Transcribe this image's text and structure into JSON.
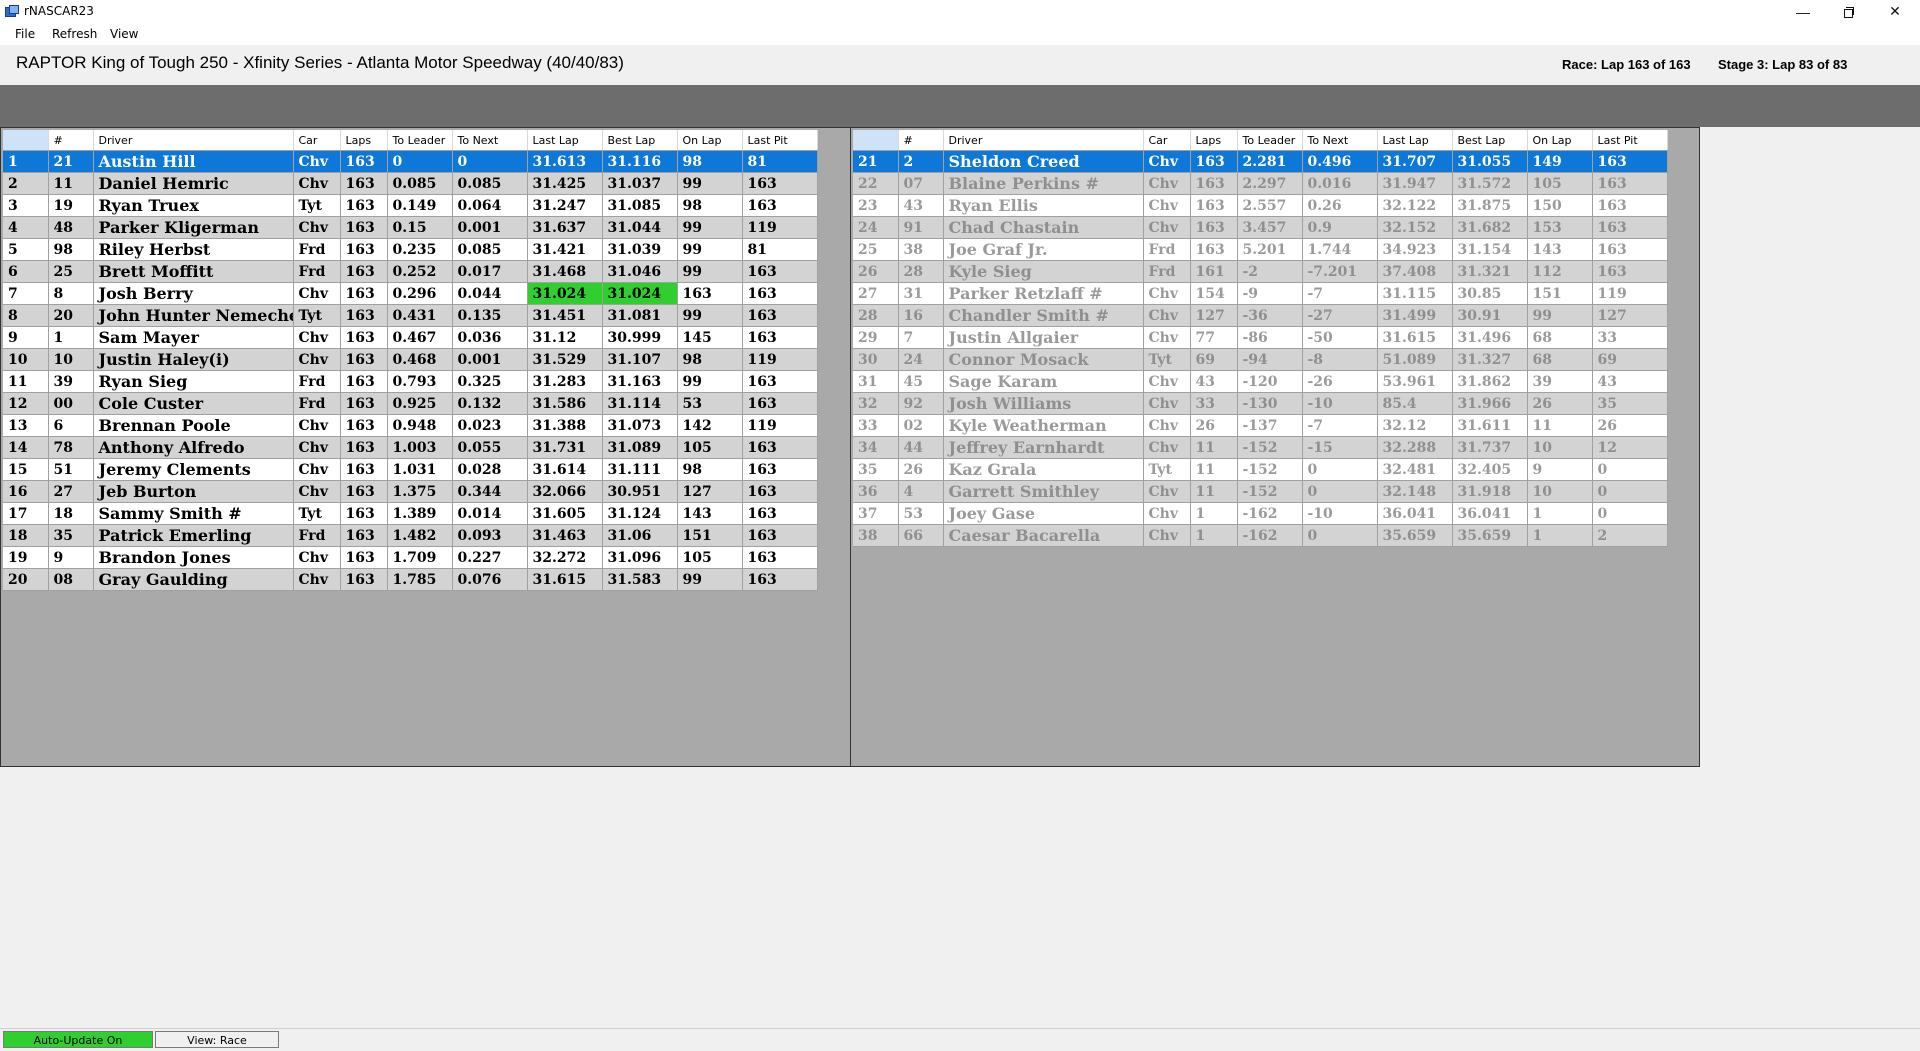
{
  "window": {
    "title": "rNASCAR23",
    "minimize_glyph": "—",
    "close_glyph": "✕"
  },
  "menu": {
    "file": "File",
    "refresh": "Refresh",
    "view": "View"
  },
  "header": {
    "race_title": "RAPTOR King of Tough 250 - Xfinity Series - Atlanta Motor Speedway  (40/40/83)",
    "race_status": "Race: Lap 163 of 163",
    "stage_status": "Stage 3: Lap 83 of 83"
  },
  "columns": [
    "",
    "#",
    "Driver",
    "Car",
    "Laps",
    "To Leader",
    "To Next",
    "Last Lap",
    "Best Lap",
    "On Lap",
    "Last Pit"
  ],
  "colors": {
    "selected": "#0e78d8",
    "best_lap": "#2fcf2f",
    "auto_update": "#2fcf2f"
  },
  "standings_left": [
    {
      "pos": "1",
      "num": "21",
      "driver": "Austin Hill",
      "car": "Chv",
      "laps": "163",
      "to_leader": "0",
      "to_next": "0",
      "last_lap": "31.613",
      "best_lap": "31.116",
      "on_lap": "98",
      "last_pit": "81",
      "selected": true
    },
    {
      "pos": "2",
      "num": "11",
      "driver": "Daniel Hemric",
      "car": "Chv",
      "laps": "163",
      "to_leader": "0.085",
      "to_next": "0.085",
      "last_lap": "31.425",
      "best_lap": "31.037",
      "on_lap": "99",
      "last_pit": "163"
    },
    {
      "pos": "3",
      "num": "19",
      "driver": "Ryan Truex",
      "car": "Tyt",
      "laps": "163",
      "to_leader": "0.149",
      "to_next": "0.064",
      "last_lap": "31.247",
      "best_lap": "31.085",
      "on_lap": "98",
      "last_pit": "163"
    },
    {
      "pos": "4",
      "num": "48",
      "driver": "Parker Kligerman",
      "car": "Chv",
      "laps": "163",
      "to_leader": "0.15",
      "to_next": "0.001",
      "last_lap": "31.637",
      "best_lap": "31.044",
      "on_lap": "99",
      "last_pit": "119"
    },
    {
      "pos": "5",
      "num": "98",
      "driver": "Riley Herbst",
      "car": "Frd",
      "laps": "163",
      "to_leader": "0.235",
      "to_next": "0.085",
      "last_lap": "31.421",
      "best_lap": "31.039",
      "on_lap": "99",
      "last_pit": "81"
    },
    {
      "pos": "6",
      "num": "25",
      "driver": "Brett Moffitt",
      "car": "Frd",
      "laps": "163",
      "to_leader": "0.252",
      "to_next": "0.017",
      "last_lap": "31.468",
      "best_lap": "31.046",
      "on_lap": "99",
      "last_pit": "163"
    },
    {
      "pos": "7",
      "num": "8",
      "driver": "Josh Berry",
      "car": "Chv",
      "laps": "163",
      "to_leader": "0.296",
      "to_next": "0.044",
      "last_lap": "31.024",
      "best_lap": "31.024",
      "on_lap": "163",
      "last_pit": "163",
      "highlight": true
    },
    {
      "pos": "8",
      "num": "20",
      "driver": "John Hunter Nemechek",
      "car": "Tyt",
      "laps": "163",
      "to_leader": "0.431",
      "to_next": "0.135",
      "last_lap": "31.451",
      "best_lap": "31.081",
      "on_lap": "99",
      "last_pit": "163"
    },
    {
      "pos": "9",
      "num": "1",
      "driver": "Sam Mayer",
      "car": "Chv",
      "laps": "163",
      "to_leader": "0.467",
      "to_next": "0.036",
      "last_lap": "31.12",
      "best_lap": "30.999",
      "on_lap": "145",
      "last_pit": "163"
    },
    {
      "pos": "10",
      "num": "10",
      "driver": "Justin Haley(i)",
      "car": "Chv",
      "laps": "163",
      "to_leader": "0.468",
      "to_next": "0.001",
      "last_lap": "31.529",
      "best_lap": "31.107",
      "on_lap": "98",
      "last_pit": "119"
    },
    {
      "pos": "11",
      "num": "39",
      "driver": "Ryan Sieg",
      "car": "Frd",
      "laps": "163",
      "to_leader": "0.793",
      "to_next": "0.325",
      "last_lap": "31.283",
      "best_lap": "31.163",
      "on_lap": "99",
      "last_pit": "163"
    },
    {
      "pos": "12",
      "num": "00",
      "driver": "Cole Custer",
      "car": "Frd",
      "laps": "163",
      "to_leader": "0.925",
      "to_next": "0.132",
      "last_lap": "31.586",
      "best_lap": "31.114",
      "on_lap": "53",
      "last_pit": "163"
    },
    {
      "pos": "13",
      "num": "6",
      "driver": "Brennan Poole",
      "car": "Chv",
      "laps": "163",
      "to_leader": "0.948",
      "to_next": "0.023",
      "last_lap": "31.388",
      "best_lap": "31.073",
      "on_lap": "142",
      "last_pit": "119"
    },
    {
      "pos": "14",
      "num": "78",
      "driver": "Anthony Alfredo",
      "car": "Chv",
      "laps": "163",
      "to_leader": "1.003",
      "to_next": "0.055",
      "last_lap": "31.731",
      "best_lap": "31.089",
      "on_lap": "105",
      "last_pit": "163"
    },
    {
      "pos": "15",
      "num": "51",
      "driver": "Jeremy Clements",
      "car": "Chv",
      "laps": "163",
      "to_leader": "1.031",
      "to_next": "0.028",
      "last_lap": "31.614",
      "best_lap": "31.111",
      "on_lap": "98",
      "last_pit": "163"
    },
    {
      "pos": "16",
      "num": "27",
      "driver": "Jeb Burton",
      "car": "Chv",
      "laps": "163",
      "to_leader": "1.375",
      "to_next": "0.344",
      "last_lap": "32.066",
      "best_lap": "30.951",
      "on_lap": "127",
      "last_pit": "163"
    },
    {
      "pos": "17",
      "num": "18",
      "driver": "Sammy Smith #",
      "car": "Tyt",
      "laps": "163",
      "to_leader": "1.389",
      "to_next": "0.014",
      "last_lap": "31.605",
      "best_lap": "31.124",
      "on_lap": "143",
      "last_pit": "163"
    },
    {
      "pos": "18",
      "num": "35",
      "driver": "Patrick Emerling",
      "car": "Frd",
      "laps": "163",
      "to_leader": "1.482",
      "to_next": "0.093",
      "last_lap": "31.463",
      "best_lap": "31.06",
      "on_lap": "151",
      "last_pit": "163"
    },
    {
      "pos": "19",
      "num": "9",
      "driver": "Brandon Jones",
      "car": "Chv",
      "laps": "163",
      "to_leader": "1.709",
      "to_next": "0.227",
      "last_lap": "32.272",
      "best_lap": "31.096",
      "on_lap": "105",
      "last_pit": "163"
    },
    {
      "pos": "20",
      "num": "08",
      "driver": "Gray Gaulding",
      "car": "Chv",
      "laps": "163",
      "to_leader": "1.785",
      "to_next": "0.076",
      "last_lap": "31.615",
      "best_lap": "31.583",
      "on_lap": "99",
      "last_pit": "163"
    }
  ],
  "standings_right": [
    {
      "pos": "21",
      "num": "2",
      "driver": "Sheldon Creed",
      "car": "Chv",
      "laps": "163",
      "to_leader": "2.281",
      "to_next": "0.496",
      "last_lap": "31.707",
      "best_lap": "31.055",
      "on_lap": "149",
      "last_pit": "163",
      "selected": true
    },
    {
      "pos": "22",
      "num": "07",
      "driver": "Blaine Perkins #",
      "car": "Chv",
      "laps": "163",
      "to_leader": "2.297",
      "to_next": "0.016",
      "last_lap": "31.947",
      "best_lap": "31.572",
      "on_lap": "105",
      "last_pit": "163",
      "faded": true
    },
    {
      "pos": "23",
      "num": "43",
      "driver": "Ryan Ellis",
      "car": "Chv",
      "laps": "163",
      "to_leader": "2.557",
      "to_next": "0.26",
      "last_lap": "32.122",
      "best_lap": "31.875",
      "on_lap": "150",
      "last_pit": "163",
      "faded": true
    },
    {
      "pos": "24",
      "num": "91",
      "driver": "Chad Chastain",
      "car": "Chv",
      "laps": "163",
      "to_leader": "3.457",
      "to_next": "0.9",
      "last_lap": "32.152",
      "best_lap": "31.682",
      "on_lap": "153",
      "last_pit": "163",
      "faded": true
    },
    {
      "pos": "25",
      "num": "38",
      "driver": "Joe Graf Jr.",
      "car": "Frd",
      "laps": "163",
      "to_leader": "5.201",
      "to_next": "1.744",
      "last_lap": "34.923",
      "best_lap": "31.154",
      "on_lap": "143",
      "last_pit": "163",
      "faded": true
    },
    {
      "pos": "26",
      "num": "28",
      "driver": "Kyle Sieg",
      "car": "Frd",
      "laps": "161",
      "to_leader": "-2",
      "to_next": "-7.201",
      "last_lap": "37.408",
      "best_lap": "31.321",
      "on_lap": "112",
      "last_pit": "163",
      "faded": true
    },
    {
      "pos": "27",
      "num": "31",
      "driver": "Parker Retzlaff #",
      "car": "Chv",
      "laps": "154",
      "to_leader": "-9",
      "to_next": "-7",
      "last_lap": "31.115",
      "best_lap": "30.85",
      "on_lap": "151",
      "last_pit": "119",
      "faded": true
    },
    {
      "pos": "28",
      "num": "16",
      "driver": "Chandler Smith #",
      "car": "Chv",
      "laps": "127",
      "to_leader": "-36",
      "to_next": "-27",
      "last_lap": "31.499",
      "best_lap": "30.91",
      "on_lap": "99",
      "last_pit": "127",
      "faded": true
    },
    {
      "pos": "29",
      "num": "7",
      "driver": "Justin Allgaier",
      "car": "Chv",
      "laps": "77",
      "to_leader": "-86",
      "to_next": "-50",
      "last_lap": "31.615",
      "best_lap": "31.496",
      "on_lap": "68",
      "last_pit": "33",
      "faded": true
    },
    {
      "pos": "30",
      "num": "24",
      "driver": "Connor Mosack",
      "car": "Tyt",
      "laps": "69",
      "to_leader": "-94",
      "to_next": "-8",
      "last_lap": "51.089",
      "best_lap": "31.327",
      "on_lap": "68",
      "last_pit": "69",
      "faded": true
    },
    {
      "pos": "31",
      "num": "45",
      "driver": "Sage Karam",
      "car": "Chv",
      "laps": "43",
      "to_leader": "-120",
      "to_next": "-26",
      "last_lap": "53.961",
      "best_lap": "31.862",
      "on_lap": "39",
      "last_pit": "43",
      "faded": true
    },
    {
      "pos": "32",
      "num": "92",
      "driver": "Josh Williams",
      "car": "Chv",
      "laps": "33",
      "to_leader": "-130",
      "to_next": "-10",
      "last_lap": "85.4",
      "best_lap": "31.966",
      "on_lap": "26",
      "last_pit": "35",
      "faded": true
    },
    {
      "pos": "33",
      "num": "02",
      "driver": "Kyle Weatherman",
      "car": "Chv",
      "laps": "26",
      "to_leader": "-137",
      "to_next": "-7",
      "last_lap": "32.12",
      "best_lap": "31.611",
      "on_lap": "11",
      "last_pit": "26",
      "faded": true
    },
    {
      "pos": "34",
      "num": "44",
      "driver": "Jeffrey Earnhardt",
      "car": "Chv",
      "laps": "11",
      "to_leader": "-152",
      "to_next": "-15",
      "last_lap": "32.288",
      "best_lap": "31.737",
      "on_lap": "10",
      "last_pit": "12",
      "faded": true
    },
    {
      "pos": "35",
      "num": "26",
      "driver": "Kaz Grala",
      "car": "Tyt",
      "laps": "11",
      "to_leader": "-152",
      "to_next": "0",
      "last_lap": "32.481",
      "best_lap": "32.405",
      "on_lap": "9",
      "last_pit": "0",
      "faded": true
    },
    {
      "pos": "36",
      "num": "4",
      "driver": "Garrett Smithley",
      "car": "Chv",
      "laps": "11",
      "to_leader": "-152",
      "to_next": "0",
      "last_lap": "32.148",
      "best_lap": "31.918",
      "on_lap": "10",
      "last_pit": "0",
      "faded": true
    },
    {
      "pos": "37",
      "num": "53",
      "driver": "Joey Gase",
      "car": "Chv",
      "laps": "1",
      "to_leader": "-162",
      "to_next": "-10",
      "last_lap": "36.041",
      "best_lap": "36.041",
      "on_lap": "1",
      "last_pit": "0",
      "faded": true
    },
    {
      "pos": "38",
      "num": "66",
      "driver": "Caesar Bacarella",
      "car": "Chv",
      "laps": "1",
      "to_leader": "-162",
      "to_next": "0",
      "last_lap": "35.659",
      "best_lap": "35.659",
      "on_lap": "1",
      "last_pit": "2",
      "faded": true
    }
  ],
  "status": {
    "auto_update": "Auto-Update On",
    "view": "View: Race"
  }
}
